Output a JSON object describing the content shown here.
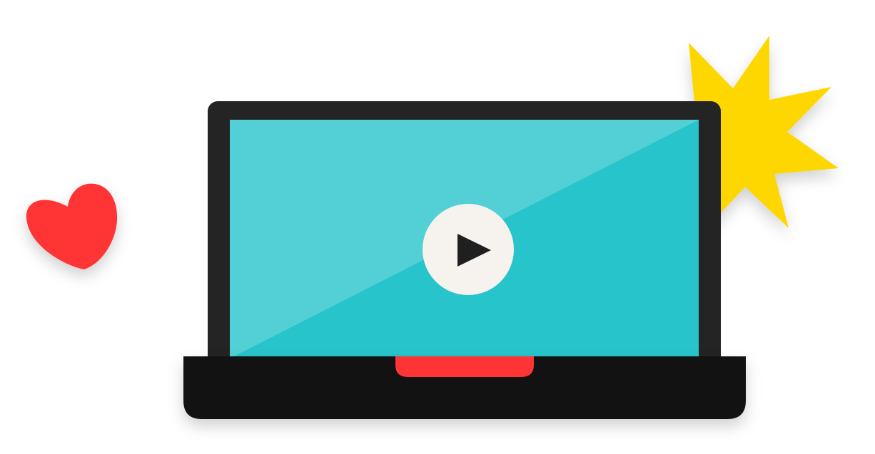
{
  "illustration": {
    "subject": "laptop-video-player",
    "icons": {
      "heart": "heart-icon",
      "burst": "starburst-icon",
      "play": "play-icon"
    },
    "colors": {
      "background": "#ffffff",
      "laptop_bezel": "#242424",
      "laptop_base": "#121212",
      "screen_light": "#52d0d6",
      "screen_dark": "#28c4cc",
      "play_circle": "#f6f3ee",
      "play_triangle": "#1f1f1f",
      "notch": "#ff3535",
      "heart": "#ff3535",
      "starburst": "#ffd700"
    }
  }
}
